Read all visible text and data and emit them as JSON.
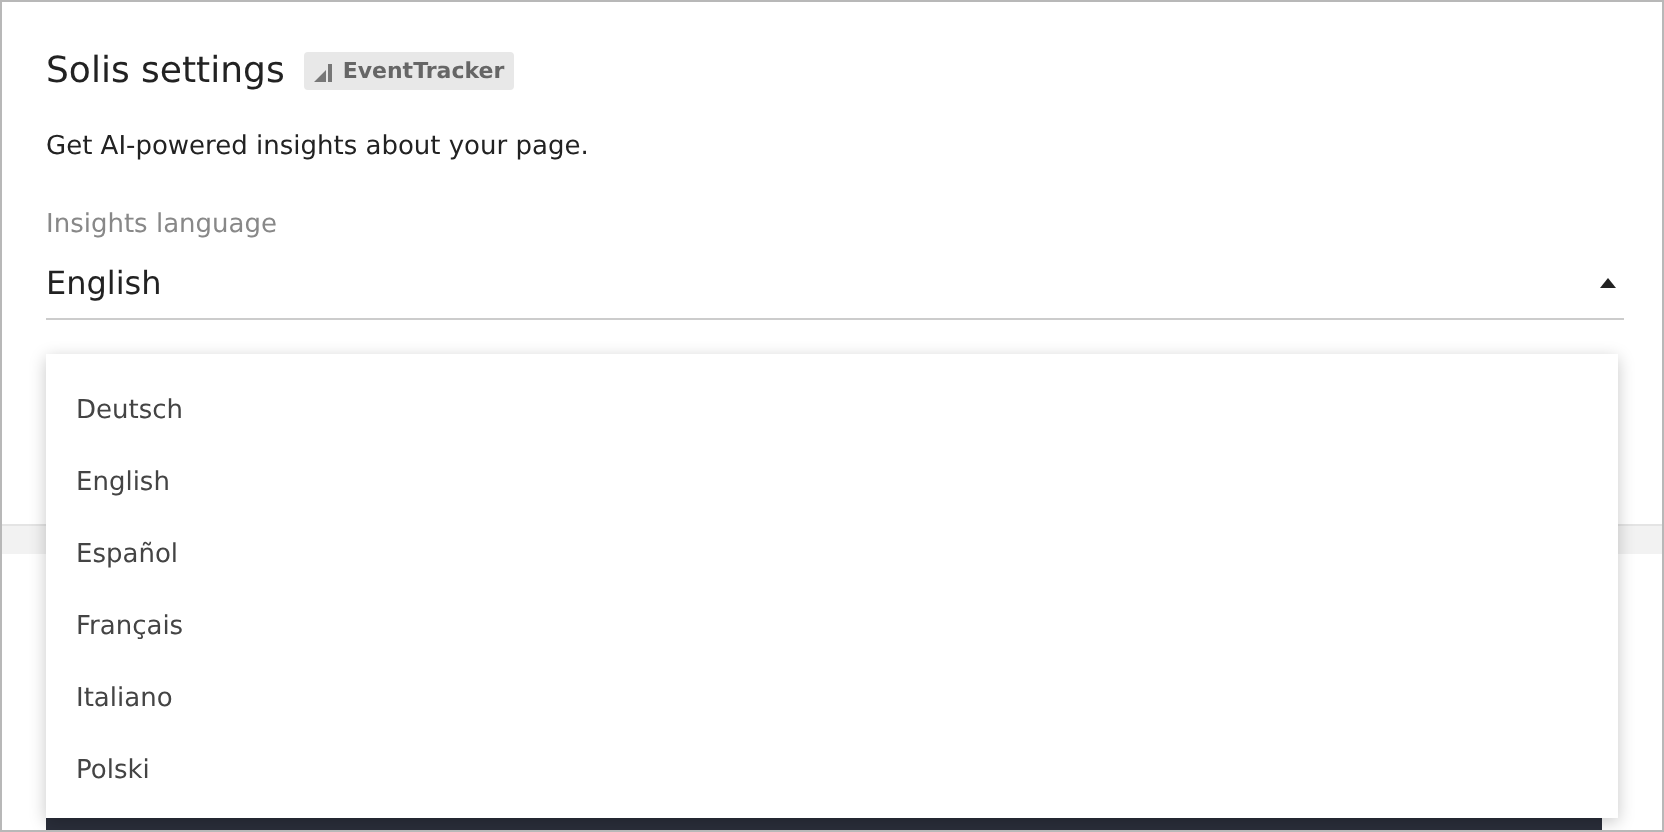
{
  "dialog": {
    "title": "Solis settings",
    "badge": "EventTracker",
    "description": "Get AI-powered insights about your page."
  },
  "language_field": {
    "label": "Insights language",
    "value": "English",
    "expanded": true
  },
  "language_menu": {
    "options": [
      {
        "label": "Deutsch"
      },
      {
        "label": "English"
      },
      {
        "label": "Español"
      },
      {
        "label": "Français"
      },
      {
        "label": "Italiano"
      },
      {
        "label": "Polski"
      }
    ]
  }
}
